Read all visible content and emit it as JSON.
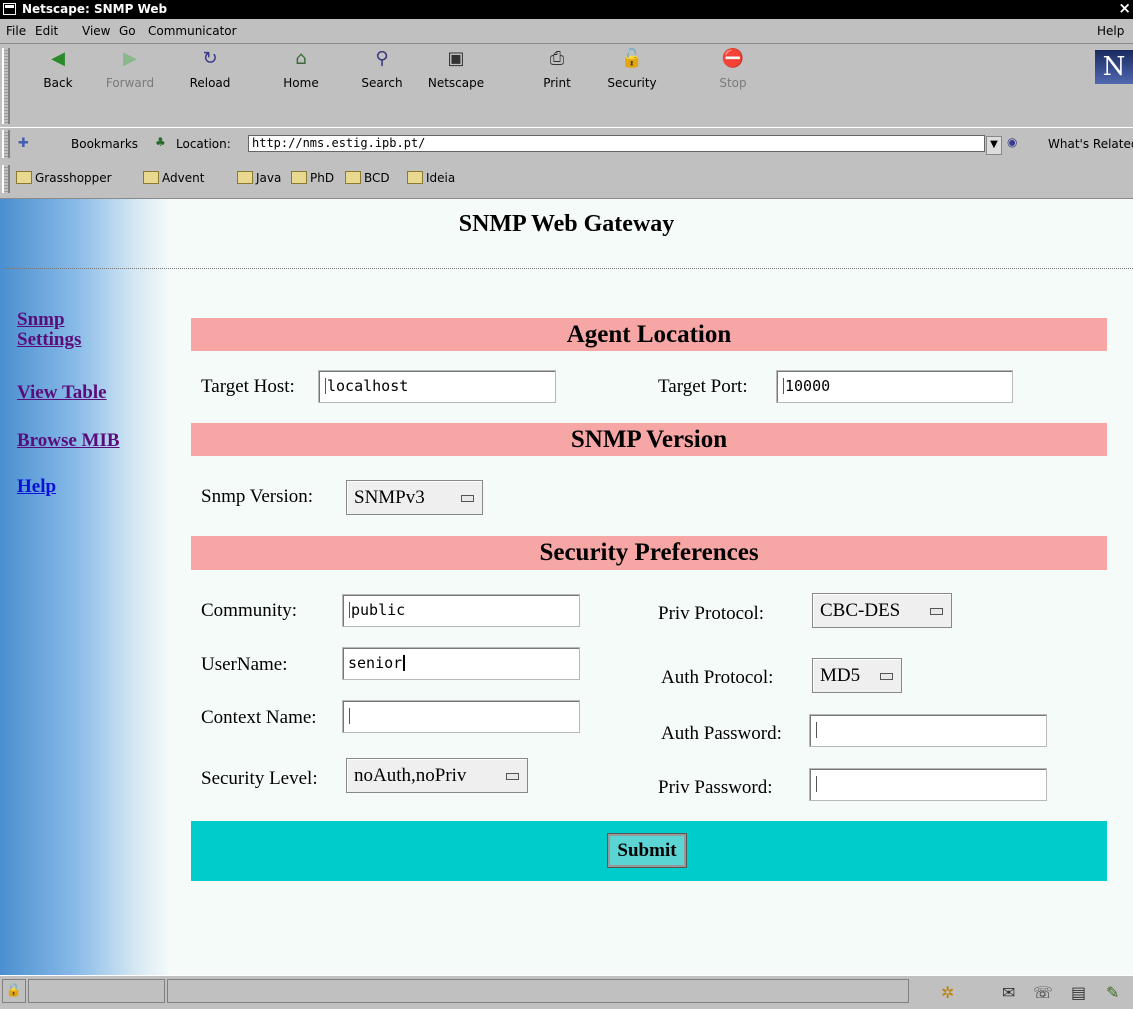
{
  "window": {
    "title": "Netscape: SNMP Web",
    "close_glyph": "×"
  },
  "menu": {
    "file": "File",
    "edit": "Edit",
    "view": "View",
    "go": "Go",
    "communicator": "Communicator",
    "help": "Help"
  },
  "toolbar": {
    "back": "Back",
    "forward": "Forward",
    "reload": "Reload",
    "home": "Home",
    "search": "Search",
    "netscape": "Netscape",
    "print": "Print",
    "security": "Security",
    "stop": "Stop",
    "logo": "N"
  },
  "location": {
    "bookmarks": "Bookmarks",
    "label": "Location:",
    "url": "http://nms.estig.ipb.pt/",
    "related": "What's Related"
  },
  "personal_bar": [
    "Grasshopper",
    "Advent",
    "Java",
    "PhD",
    "BCD",
    "Ideia"
  ],
  "page": {
    "title": "SNMP Web Gateway",
    "nav": {
      "snmp_settings_1": "Snmp",
      "snmp_settings_2": "Settings",
      "view_table": "View Table",
      "browse_mib": "Browse MIB",
      "help": "Help"
    },
    "sections": {
      "agent": "Agent Location",
      "version": "SNMP Version",
      "security": "Security Preferences"
    },
    "agent": {
      "host_label": "Target Host:",
      "host_value": "localhost",
      "port_label": "Target Port:",
      "port_value": "10000"
    },
    "version": {
      "label": "Snmp Version:",
      "value": "SNMPv3"
    },
    "security": {
      "community_label": "Community:",
      "community_value": "public",
      "username_label": "UserName:",
      "username_value": "senior",
      "context_label": "Context Name:",
      "context_value": "",
      "level_label": "Security Level:",
      "level_value": "noAuth,noPriv",
      "priv_protocol_label": "Priv Protocol:",
      "priv_protocol_value": "CBC-DES",
      "auth_protocol_label": "Auth Protocol:",
      "auth_protocol_value": "MD5",
      "auth_password_label": "Auth Password:",
      "auth_password_value": "",
      "priv_password_label": "Priv Password:",
      "priv_password_value": ""
    },
    "submit": "Submit"
  }
}
